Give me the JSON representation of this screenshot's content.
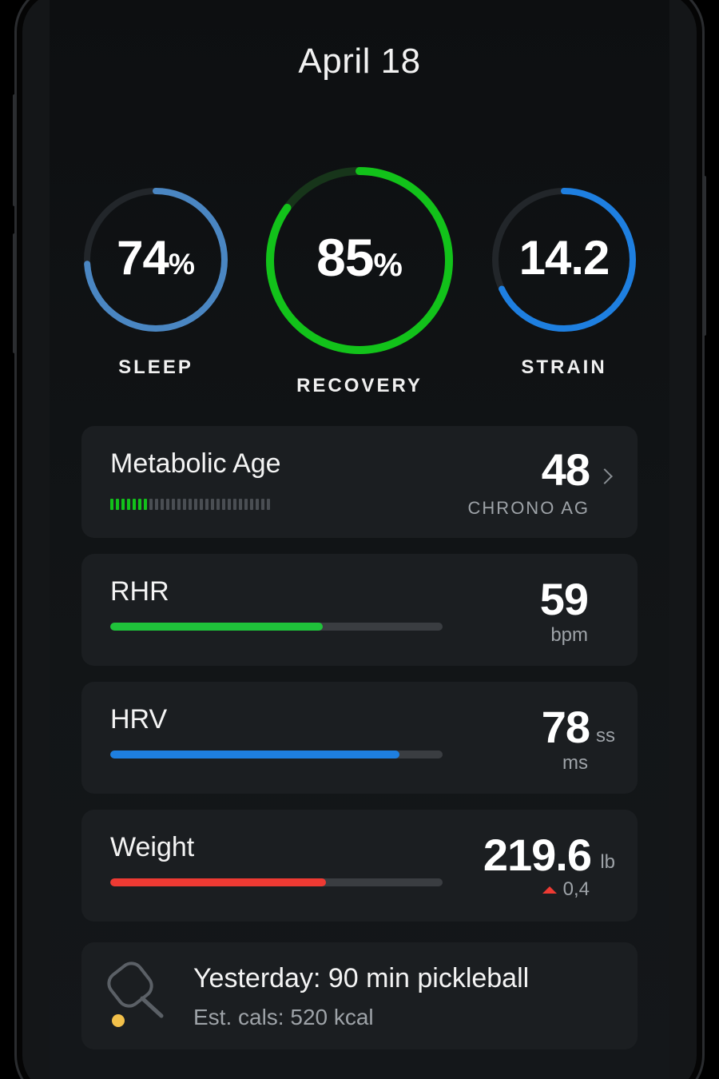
{
  "date": "April 18",
  "rings": {
    "sleep": {
      "value": "74",
      "unit": "%",
      "label": "SLEEP",
      "fraction": 0.74,
      "color": "#4a86c2"
    },
    "recovery": {
      "value": "85",
      "unit": "%",
      "label": "RECOVERY",
      "fraction": 0.85,
      "color": "#12c21a"
    },
    "strain": {
      "value": "14.2",
      "unit": "",
      "label": "STRAIN",
      "fraction": 0.68,
      "color": "#1e7fe0"
    }
  },
  "metabolic": {
    "title": "Metabolic Age",
    "value": "48",
    "sublabel": "CHRONO AG",
    "ticks_total": 29,
    "ticks_active": 7,
    "active_color": "#12c21a"
  },
  "rhr": {
    "title": "RHR",
    "value": "59",
    "unit": "bpm",
    "fraction": 0.64,
    "color": "#1fc23a"
  },
  "hrv": {
    "title": "HRV",
    "value": "78",
    "unit_side": "ss",
    "unit": "ms",
    "fraction": 0.87,
    "color": "#1e7fe0"
  },
  "weight": {
    "title": "Weight",
    "value": "219.6",
    "unit": "lb",
    "delta": "0,4",
    "fraction": 0.65,
    "color": "#ee3a33"
  },
  "activity": {
    "headline": "Yesterday: 90 min pickleball",
    "subline": "Est. cals: 520 kcal",
    "icon": "pickleball-paddle-icon"
  }
}
